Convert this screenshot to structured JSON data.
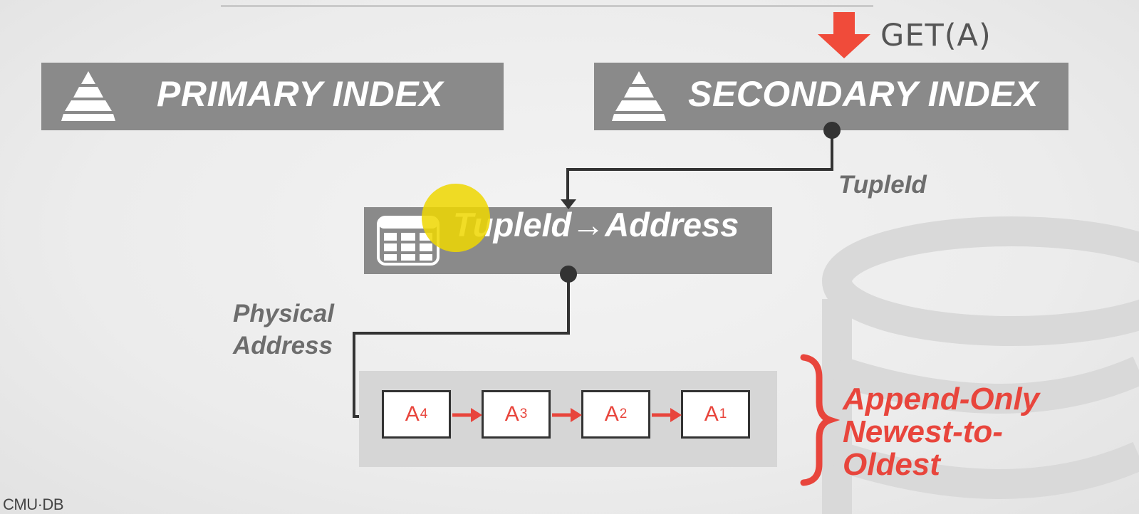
{
  "request": {
    "label": "GET(A)"
  },
  "indexes": {
    "primary": {
      "label": "PRIMARY INDEX",
      "icon": "pyramid-icon"
    },
    "secondary": {
      "label": "SECONDARY INDEX",
      "icon": "pyramid-icon"
    }
  },
  "mapping": {
    "label": "TupleId→Address",
    "icon": "table-icon"
  },
  "edges": {
    "secondary_to_mapping": "TupleId",
    "mapping_to_chain_line1": "Physical",
    "mapping_to_chain_line2": "Address"
  },
  "chain": {
    "versions": [
      {
        "name": "A",
        "sub": "4"
      },
      {
        "name": "A",
        "sub": "3"
      },
      {
        "name": "A",
        "sub": "2"
      },
      {
        "name": "A",
        "sub": "1"
      }
    ],
    "note_line1": "Append-Only",
    "note_line2": "Newest-to-",
    "note_line3": "Oldest"
  },
  "footer": {
    "logo": "CMU·DB"
  },
  "colors": {
    "accent": "#e8453c",
    "box": "#8a8a8a",
    "connector": "#333333"
  }
}
